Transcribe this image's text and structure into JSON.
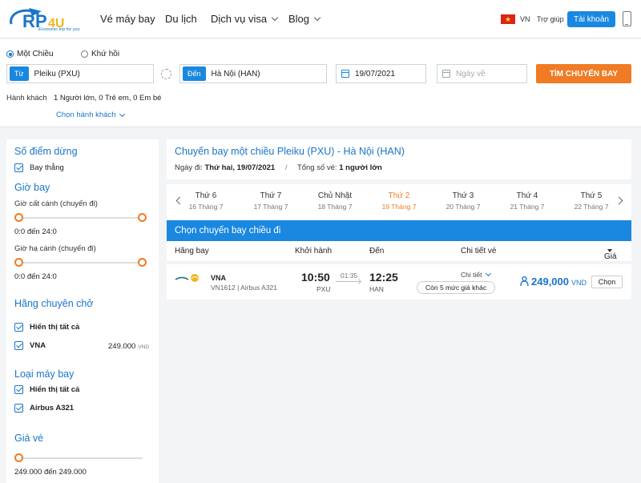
{
  "colors": {
    "brand": "#1a75c9",
    "primary_button": "#1a88e0",
    "accent": "#f07b24"
  },
  "header": {
    "logo_text": "RP4U",
    "logo_tagline": "Economic trip for you",
    "nav": [
      {
        "label": "Vé máy bay",
        "has_dropdown": false
      },
      {
        "label": "Du lịch",
        "has_dropdown": false
      },
      {
        "label": "Dịch vụ visa",
        "has_dropdown": true
      },
      {
        "label": "Blog",
        "has_dropdown": true
      }
    ],
    "lang": "VN",
    "help": "Trợ giúp",
    "account": "Tài khoản"
  },
  "search": {
    "trip_types": [
      {
        "label": "Một Chiều",
        "selected": true
      },
      {
        "label": "Khứ hồi",
        "selected": false
      }
    ],
    "from_tag": "Từ",
    "from_value": "Pleiku (PXU)",
    "to_tag": "Đến",
    "to_value": "Hà Nội (HAN)",
    "depart_date": "19/07/2021",
    "return_placeholder": "Ngày về",
    "search_button": "TÌM CHUYẾN BAY",
    "passenger_label": "Hành khách",
    "passenger_value": "1 Người lớn, 0 Trẻ em, 0 Em bé",
    "passenger_select": "Chọn hành khách"
  },
  "sidebar": {
    "stops_title": "Số điểm dừng",
    "stops_option": "Bay thẳng",
    "time_title": "Giờ bay",
    "takeoff_label": "Giờ cất cánh (chuyến đi)",
    "takeoff_range": "0:0 đến 24:0",
    "landing_label": "Giờ hạ cánh (chuyến đi)",
    "landing_range": "0:0 đến 24:0",
    "carrier_title": "Hãng chuyên chở",
    "carrier_all": "Hiển thị tất cả",
    "carrier_vna": "VNA",
    "carrier_vna_price": "249.000",
    "carrier_vna_currency": "VND",
    "aircraft_title": "Loại máy bay",
    "aircraft_all": "Hiển thị tất cả",
    "aircraft_type": "Airbus A321",
    "price_title": "Giá vé",
    "price_range": "249.000 đến 249.000"
  },
  "main": {
    "route_title": "Chuyến bay một chiều Pleiku (PXU) - Hà Nội (HAN)",
    "date_label": "Ngày đi:",
    "date_value": "Thứ hai, 19/07/2021",
    "total_label": "Tổng số vé:",
    "total_value": "1 người lớn",
    "days": [
      {
        "name": "Thứ 6",
        "date": "16 Tháng 7",
        "active": false
      },
      {
        "name": "Thứ 7",
        "date": "17 Tháng 7",
        "active": false
      },
      {
        "name": "Chủ Nhật",
        "date": "18 Tháng 7",
        "active": false
      },
      {
        "name": "Thứ 2",
        "date": "19 Tháng 7",
        "active": true
      },
      {
        "name": "Thứ 3",
        "date": "20 Tháng 7",
        "active": false
      },
      {
        "name": "Thứ 4",
        "date": "21 Tháng 7",
        "active": false
      },
      {
        "name": "Thứ 5",
        "date": "22 Tháng 7",
        "active": false
      }
    ],
    "list_header": "Chọn chuyến bay chiều đi",
    "columns": {
      "airline": "Hãng bay",
      "depart": "Khởi hành",
      "arrive": "Đến",
      "detail": "Chi tiết vé",
      "price": "Giá"
    },
    "flight": {
      "airline": "VNA",
      "code_aircraft": "VN1612  |  Airbus A321",
      "depart_time": "10:50",
      "depart_code": "PXU",
      "duration": "01:35",
      "arrive_time": "12:25",
      "arrive_code": "HAN",
      "detail_link": "Chi tiết",
      "more_prices": "Còn 5 mức giá khác",
      "price": "249,000",
      "currency": "VND",
      "choose": "Chọn"
    }
  }
}
